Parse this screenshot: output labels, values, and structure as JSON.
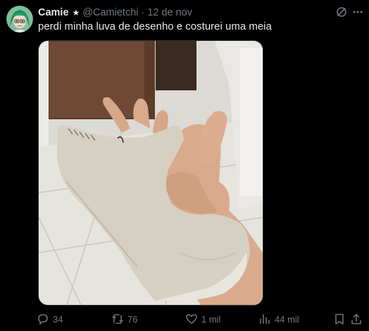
{
  "post": {
    "author": {
      "display_name": "Camie",
      "badge": "★",
      "handle": "@Camietchi",
      "separator": "·",
      "date": "12 de nov",
      "avatar_icon": "anime-avatar-green-hair"
    },
    "text": "perdi minha luva de desenho e costurei uma meia",
    "media": {
      "type": "photo",
      "subject": "hand-wearing-sewn-sock-glove"
    },
    "actions": {
      "replies": "34",
      "reposts": "76",
      "likes": "1 mil",
      "views": "44 mil"
    },
    "icons": {
      "grok": "grok-icon",
      "more": "more-icon",
      "reply": "reply-icon",
      "repost": "repost-icon",
      "like": "heart-icon",
      "views": "views-icon",
      "bookmark": "bookmark-icon",
      "share": "share-icon"
    }
  },
  "colors": {
    "background": "#000000",
    "text_primary": "#e7e9ea",
    "text_secondary": "#71767b",
    "border": "#2f3336"
  }
}
